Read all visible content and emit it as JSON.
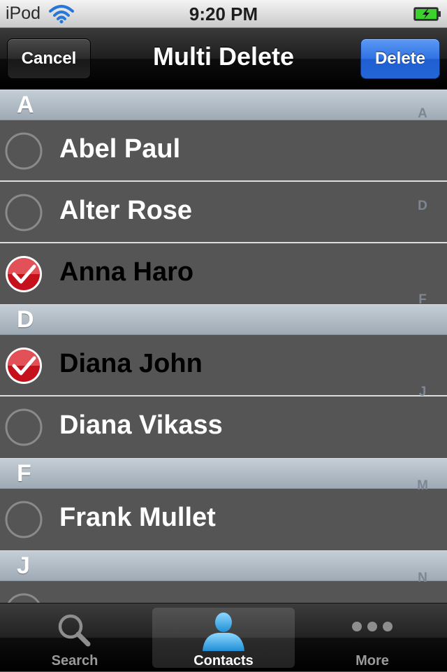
{
  "status_bar": {
    "carrier": "iPod",
    "time": "9:20 PM",
    "icons": [
      "wifi-icon",
      "battery-charging-icon"
    ]
  },
  "nav": {
    "title": "Multi Delete",
    "cancel_label": "Cancel",
    "delete_label": "Delete"
  },
  "sections": [
    {
      "letter": "A",
      "contacts": [
        {
          "name": "Abel Paul",
          "selected": false
        },
        {
          "name": "Alter Rose",
          "selected": false
        },
        {
          "name": "Anna Haro",
          "selected": true
        }
      ]
    },
    {
      "letter": "D",
      "contacts": [
        {
          "name": "Diana John",
          "selected": true
        },
        {
          "name": "Diana Vikass",
          "selected": false
        }
      ]
    },
    {
      "letter": "F",
      "contacts": [
        {
          "name": "Frank Mullet",
          "selected": false
        }
      ]
    },
    {
      "letter": "J",
      "contacts": []
    }
  ],
  "index": [
    "A",
    "D",
    "F",
    "J",
    "M",
    "N"
  ],
  "tabs": [
    {
      "label": "Search",
      "icon": "magnifier-icon",
      "active": false
    },
    {
      "label": "Contacts",
      "icon": "person-icon",
      "active": true
    },
    {
      "label": "More",
      "icon": "more-dots-icon",
      "active": false
    }
  ],
  "colors": {
    "checked": "#c4111b",
    "delete_button": "#2f72e3",
    "list_bg": "#555555",
    "tab_active_icon": "#3aaee8"
  }
}
